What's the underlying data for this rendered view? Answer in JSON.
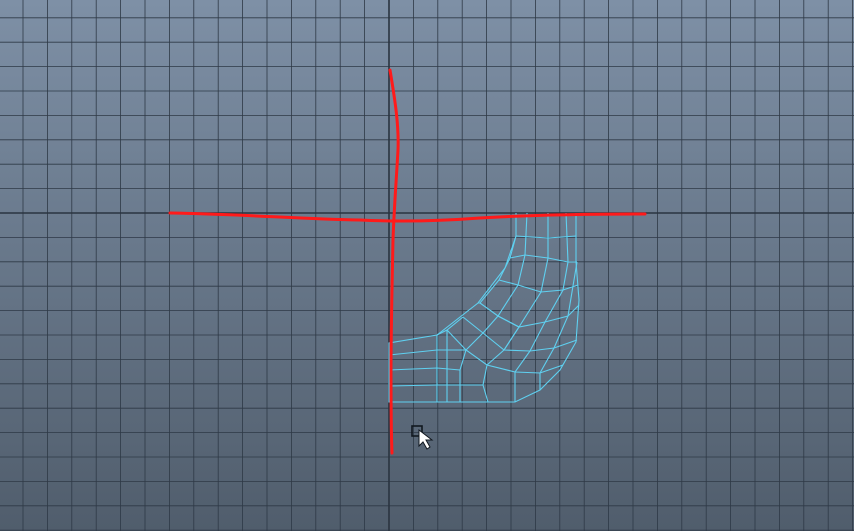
{
  "viewport": {
    "view": "orthographic-front",
    "background_top": "#7e90a6",
    "background_bottom": "#505d6c",
    "grid": true,
    "grid_color": "#2e3946",
    "axis_color": "#2a3440"
  },
  "annotation": {
    "stroke_color": "#ff1a1a",
    "description_marks": [
      "horizontal-stroke",
      "vertical-stroke"
    ]
  },
  "mesh": {
    "wireframe_color": "#5fd0f0",
    "selected": true
  },
  "cursor": {
    "icon": "select-box-cursor-icon"
  }
}
